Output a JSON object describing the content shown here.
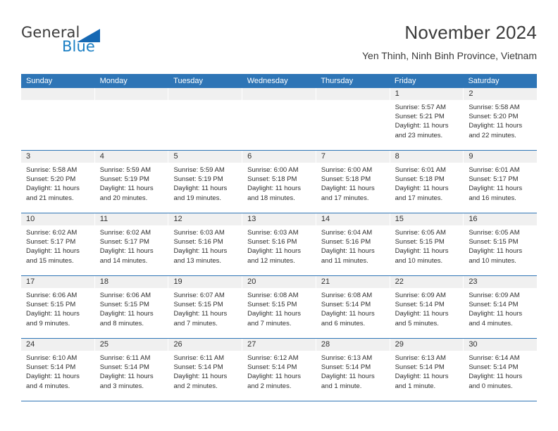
{
  "brand": {
    "name_line1": "General",
    "name_line2": "Blue",
    "accent_color": "#1668b3",
    "text_color": "#3b3b3b"
  },
  "header": {
    "month_title": "November 2024",
    "location": "Yen Thinh, Ninh Binh Province, Vietnam"
  },
  "theme": {
    "header_blue": "#2e75b6",
    "day_strip_gray": "#f0f0f0",
    "text": "#2f2f2f"
  },
  "weekdays": [
    "Sunday",
    "Monday",
    "Tuesday",
    "Wednesday",
    "Thursday",
    "Friday",
    "Saturday"
  ],
  "weeks": [
    [
      {
        "day": "",
        "sunrise": "",
        "sunset": "",
        "daylight1": "",
        "daylight2": ""
      },
      {
        "day": "",
        "sunrise": "",
        "sunset": "",
        "daylight1": "",
        "daylight2": ""
      },
      {
        "day": "",
        "sunrise": "",
        "sunset": "",
        "daylight1": "",
        "daylight2": ""
      },
      {
        "day": "",
        "sunrise": "",
        "sunset": "",
        "daylight1": "",
        "daylight2": ""
      },
      {
        "day": "",
        "sunrise": "",
        "sunset": "",
        "daylight1": "",
        "daylight2": ""
      },
      {
        "day": "1",
        "sunrise": "Sunrise: 5:57 AM",
        "sunset": "Sunset: 5:21 PM",
        "daylight1": "Daylight: 11 hours",
        "daylight2": "and 23 minutes."
      },
      {
        "day": "2",
        "sunrise": "Sunrise: 5:58 AM",
        "sunset": "Sunset: 5:20 PM",
        "daylight1": "Daylight: 11 hours",
        "daylight2": "and 22 minutes."
      }
    ],
    [
      {
        "day": "3",
        "sunrise": "Sunrise: 5:58 AM",
        "sunset": "Sunset: 5:20 PM",
        "daylight1": "Daylight: 11 hours",
        "daylight2": "and 21 minutes."
      },
      {
        "day": "4",
        "sunrise": "Sunrise: 5:59 AM",
        "sunset": "Sunset: 5:19 PM",
        "daylight1": "Daylight: 11 hours",
        "daylight2": "and 20 minutes."
      },
      {
        "day": "5",
        "sunrise": "Sunrise: 5:59 AM",
        "sunset": "Sunset: 5:19 PM",
        "daylight1": "Daylight: 11 hours",
        "daylight2": "and 19 minutes."
      },
      {
        "day": "6",
        "sunrise": "Sunrise: 6:00 AM",
        "sunset": "Sunset: 5:18 PM",
        "daylight1": "Daylight: 11 hours",
        "daylight2": "and 18 minutes."
      },
      {
        "day": "7",
        "sunrise": "Sunrise: 6:00 AM",
        "sunset": "Sunset: 5:18 PM",
        "daylight1": "Daylight: 11 hours",
        "daylight2": "and 17 minutes."
      },
      {
        "day": "8",
        "sunrise": "Sunrise: 6:01 AM",
        "sunset": "Sunset: 5:18 PM",
        "daylight1": "Daylight: 11 hours",
        "daylight2": "and 17 minutes."
      },
      {
        "day": "9",
        "sunrise": "Sunrise: 6:01 AM",
        "sunset": "Sunset: 5:17 PM",
        "daylight1": "Daylight: 11 hours",
        "daylight2": "and 16 minutes."
      }
    ],
    [
      {
        "day": "10",
        "sunrise": "Sunrise: 6:02 AM",
        "sunset": "Sunset: 5:17 PM",
        "daylight1": "Daylight: 11 hours",
        "daylight2": "and 15 minutes."
      },
      {
        "day": "11",
        "sunrise": "Sunrise: 6:02 AM",
        "sunset": "Sunset: 5:17 PM",
        "daylight1": "Daylight: 11 hours",
        "daylight2": "and 14 minutes."
      },
      {
        "day": "12",
        "sunrise": "Sunrise: 6:03 AM",
        "sunset": "Sunset: 5:16 PM",
        "daylight1": "Daylight: 11 hours",
        "daylight2": "and 13 minutes."
      },
      {
        "day": "13",
        "sunrise": "Sunrise: 6:03 AM",
        "sunset": "Sunset: 5:16 PM",
        "daylight1": "Daylight: 11 hours",
        "daylight2": "and 12 minutes."
      },
      {
        "day": "14",
        "sunrise": "Sunrise: 6:04 AM",
        "sunset": "Sunset: 5:16 PM",
        "daylight1": "Daylight: 11 hours",
        "daylight2": "and 11 minutes."
      },
      {
        "day": "15",
        "sunrise": "Sunrise: 6:05 AM",
        "sunset": "Sunset: 5:15 PM",
        "daylight1": "Daylight: 11 hours",
        "daylight2": "and 10 minutes."
      },
      {
        "day": "16",
        "sunrise": "Sunrise: 6:05 AM",
        "sunset": "Sunset: 5:15 PM",
        "daylight1": "Daylight: 11 hours",
        "daylight2": "and 10 minutes."
      }
    ],
    [
      {
        "day": "17",
        "sunrise": "Sunrise: 6:06 AM",
        "sunset": "Sunset: 5:15 PM",
        "daylight1": "Daylight: 11 hours",
        "daylight2": "and 9 minutes."
      },
      {
        "day": "18",
        "sunrise": "Sunrise: 6:06 AM",
        "sunset": "Sunset: 5:15 PM",
        "daylight1": "Daylight: 11 hours",
        "daylight2": "and 8 minutes."
      },
      {
        "day": "19",
        "sunrise": "Sunrise: 6:07 AM",
        "sunset": "Sunset: 5:15 PM",
        "daylight1": "Daylight: 11 hours",
        "daylight2": "and 7 minutes."
      },
      {
        "day": "20",
        "sunrise": "Sunrise: 6:08 AM",
        "sunset": "Sunset: 5:15 PM",
        "daylight1": "Daylight: 11 hours",
        "daylight2": "and 7 minutes."
      },
      {
        "day": "21",
        "sunrise": "Sunrise: 6:08 AM",
        "sunset": "Sunset: 5:14 PM",
        "daylight1": "Daylight: 11 hours",
        "daylight2": "and 6 minutes."
      },
      {
        "day": "22",
        "sunrise": "Sunrise: 6:09 AM",
        "sunset": "Sunset: 5:14 PM",
        "daylight1": "Daylight: 11 hours",
        "daylight2": "and 5 minutes."
      },
      {
        "day": "23",
        "sunrise": "Sunrise: 6:09 AM",
        "sunset": "Sunset: 5:14 PM",
        "daylight1": "Daylight: 11 hours",
        "daylight2": "and 4 minutes."
      }
    ],
    [
      {
        "day": "24",
        "sunrise": "Sunrise: 6:10 AM",
        "sunset": "Sunset: 5:14 PM",
        "daylight1": "Daylight: 11 hours",
        "daylight2": "and 4 minutes."
      },
      {
        "day": "25",
        "sunrise": "Sunrise: 6:11 AM",
        "sunset": "Sunset: 5:14 PM",
        "daylight1": "Daylight: 11 hours",
        "daylight2": "and 3 minutes."
      },
      {
        "day": "26",
        "sunrise": "Sunrise: 6:11 AM",
        "sunset": "Sunset: 5:14 PM",
        "daylight1": "Daylight: 11 hours",
        "daylight2": "and 2 minutes."
      },
      {
        "day": "27",
        "sunrise": "Sunrise: 6:12 AM",
        "sunset": "Sunset: 5:14 PM",
        "daylight1": "Daylight: 11 hours",
        "daylight2": "and 2 minutes."
      },
      {
        "day": "28",
        "sunrise": "Sunrise: 6:13 AM",
        "sunset": "Sunset: 5:14 PM",
        "daylight1": "Daylight: 11 hours",
        "daylight2": "and 1 minute."
      },
      {
        "day": "29",
        "sunrise": "Sunrise: 6:13 AM",
        "sunset": "Sunset: 5:14 PM",
        "daylight1": "Daylight: 11 hours",
        "daylight2": "and 1 minute."
      },
      {
        "day": "30",
        "sunrise": "Sunrise: 6:14 AM",
        "sunset": "Sunset: 5:14 PM",
        "daylight1": "Daylight: 11 hours",
        "daylight2": "and 0 minutes."
      }
    ]
  ]
}
